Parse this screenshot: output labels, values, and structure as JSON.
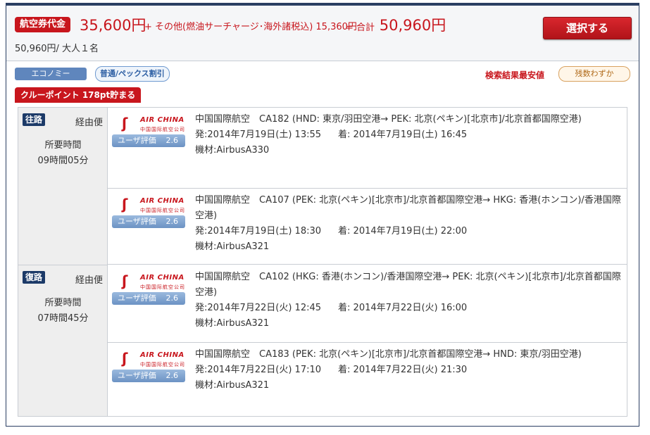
{
  "summary": {
    "fare_badge": "航空券代金",
    "base_price": "35,600円",
    "other_fees": "+ その他(燃油サーチャージ･海外諸税込) 15,360円",
    "total_label": "= 合計",
    "total_price": "50,960円",
    "per_person": "50,960円/ 大人１名",
    "select_button": "選択する"
  },
  "tags": {
    "cabin": "エコノミー",
    "fare_type": "普通/ペックス割引",
    "cheapest": "検索結果最安値",
    "few_seats": "残数わずか",
    "crew_points": "クルーポイント 178pt貯まる"
  },
  "outbound": {
    "badge": "往路",
    "route_type": "経由便",
    "duration_label": "所要時間",
    "duration": "09時間05分"
  },
  "inbound": {
    "badge": "復路",
    "route_type": "経由便",
    "duration_label": "所要時間",
    "duration": "07時間45分"
  },
  "segments": [
    {
      "airline_logo_en": "AIR CHINA",
      "airline_logo_cn": "中国国际航空公司",
      "rating_label": "ユーザ評価",
      "rating": "2.6",
      "route": "中国国際航空　CA182 (HND: 東京/羽田空港→ PEK: 北京(ペキン)[北京市]/北京首都国際空港)",
      "depart": "発:2014年7月19日(土) 13:55",
      "arrive": "着: 2014年7月19日(土) 16:45",
      "aircraft": "機材:AirbusA330"
    },
    {
      "airline_logo_en": "AIR CHINA",
      "airline_logo_cn": "中国国际航空公司",
      "rating_label": "ユーザ評価",
      "rating": "2.6",
      "route": "中国国際航空　CA107 (PEK: 北京(ペキン)[北京市]/北京首都国際空港→ HKG: 香港(ホンコン)/香港国際空港)",
      "depart": "発:2014年7月19日(土) 18:30",
      "arrive": "着: 2014年7月19日(土) 22:00",
      "aircraft": "機材:AirbusA321"
    },
    {
      "airline_logo_en": "AIR CHINA",
      "airline_logo_cn": "中国国际航空公司",
      "rating_label": "ユーザ評価",
      "rating": "2.6",
      "route": "中国国際航空　CA102 (HKG: 香港(ホンコン)/香港国際空港→ PEK: 北京(ペキン)[北京市]/北京首都国際空港)",
      "depart": "発:2014年7月22日(火) 12:45",
      "arrive": "着: 2014年7月22日(火) 16:00",
      "aircraft": "機材:AirbusA321"
    },
    {
      "airline_logo_en": "AIR CHINA",
      "airline_logo_cn": "中国国际航空公司",
      "rating_label": "ユーザ評価",
      "rating": "2.6",
      "route": "中国国際航空　CA183 (PEK: 北京(ペキン)[北京市]/北京首都国際空港→ HND: 東京/羽田空港)",
      "depart": "発:2014年7月22日(火) 17:10",
      "arrive": "着: 2014年7月22日(火) 21:30",
      "aircraft": "機材:AirbusA321"
    }
  ]
}
